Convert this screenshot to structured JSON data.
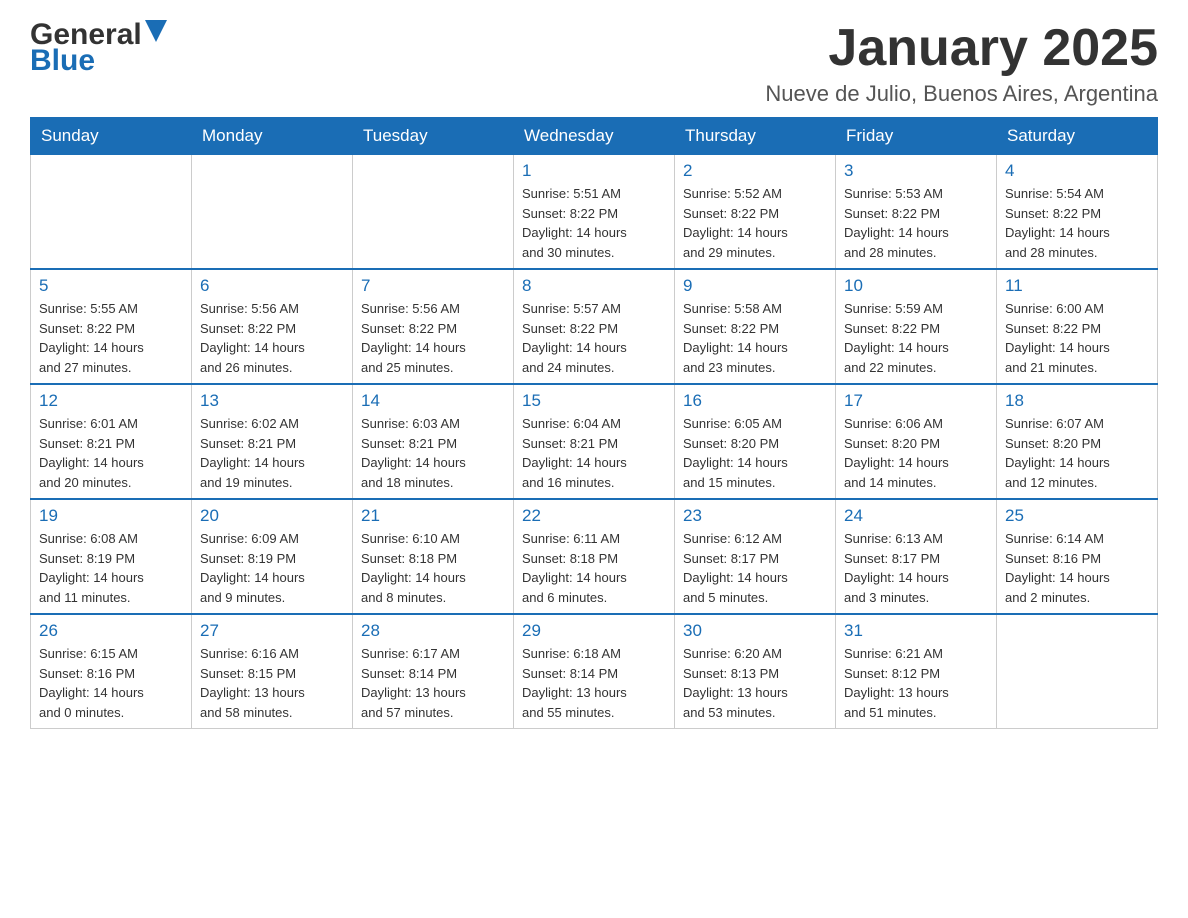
{
  "header": {
    "month_title": "January 2025",
    "location": "Nueve de Julio, Buenos Aires, Argentina",
    "logo_line1": "General",
    "logo_line2": "Blue"
  },
  "days_of_week": [
    "Sunday",
    "Monday",
    "Tuesday",
    "Wednesday",
    "Thursday",
    "Friday",
    "Saturday"
  ],
  "weeks": [
    [
      {
        "day": "",
        "info": ""
      },
      {
        "day": "",
        "info": ""
      },
      {
        "day": "",
        "info": ""
      },
      {
        "day": "1",
        "info": "Sunrise: 5:51 AM\nSunset: 8:22 PM\nDaylight: 14 hours\nand 30 minutes."
      },
      {
        "day": "2",
        "info": "Sunrise: 5:52 AM\nSunset: 8:22 PM\nDaylight: 14 hours\nand 29 minutes."
      },
      {
        "day": "3",
        "info": "Sunrise: 5:53 AM\nSunset: 8:22 PM\nDaylight: 14 hours\nand 28 minutes."
      },
      {
        "day": "4",
        "info": "Sunrise: 5:54 AM\nSunset: 8:22 PM\nDaylight: 14 hours\nand 28 minutes."
      }
    ],
    [
      {
        "day": "5",
        "info": "Sunrise: 5:55 AM\nSunset: 8:22 PM\nDaylight: 14 hours\nand 27 minutes."
      },
      {
        "day": "6",
        "info": "Sunrise: 5:56 AM\nSunset: 8:22 PM\nDaylight: 14 hours\nand 26 minutes."
      },
      {
        "day": "7",
        "info": "Sunrise: 5:56 AM\nSunset: 8:22 PM\nDaylight: 14 hours\nand 25 minutes."
      },
      {
        "day": "8",
        "info": "Sunrise: 5:57 AM\nSunset: 8:22 PM\nDaylight: 14 hours\nand 24 minutes."
      },
      {
        "day": "9",
        "info": "Sunrise: 5:58 AM\nSunset: 8:22 PM\nDaylight: 14 hours\nand 23 minutes."
      },
      {
        "day": "10",
        "info": "Sunrise: 5:59 AM\nSunset: 8:22 PM\nDaylight: 14 hours\nand 22 minutes."
      },
      {
        "day": "11",
        "info": "Sunrise: 6:00 AM\nSunset: 8:22 PM\nDaylight: 14 hours\nand 21 minutes."
      }
    ],
    [
      {
        "day": "12",
        "info": "Sunrise: 6:01 AM\nSunset: 8:21 PM\nDaylight: 14 hours\nand 20 minutes."
      },
      {
        "day": "13",
        "info": "Sunrise: 6:02 AM\nSunset: 8:21 PM\nDaylight: 14 hours\nand 19 minutes."
      },
      {
        "day": "14",
        "info": "Sunrise: 6:03 AM\nSunset: 8:21 PM\nDaylight: 14 hours\nand 18 minutes."
      },
      {
        "day": "15",
        "info": "Sunrise: 6:04 AM\nSunset: 8:21 PM\nDaylight: 14 hours\nand 16 minutes."
      },
      {
        "day": "16",
        "info": "Sunrise: 6:05 AM\nSunset: 8:20 PM\nDaylight: 14 hours\nand 15 minutes."
      },
      {
        "day": "17",
        "info": "Sunrise: 6:06 AM\nSunset: 8:20 PM\nDaylight: 14 hours\nand 14 minutes."
      },
      {
        "day": "18",
        "info": "Sunrise: 6:07 AM\nSunset: 8:20 PM\nDaylight: 14 hours\nand 12 minutes."
      }
    ],
    [
      {
        "day": "19",
        "info": "Sunrise: 6:08 AM\nSunset: 8:19 PM\nDaylight: 14 hours\nand 11 minutes."
      },
      {
        "day": "20",
        "info": "Sunrise: 6:09 AM\nSunset: 8:19 PM\nDaylight: 14 hours\nand 9 minutes."
      },
      {
        "day": "21",
        "info": "Sunrise: 6:10 AM\nSunset: 8:18 PM\nDaylight: 14 hours\nand 8 minutes."
      },
      {
        "day": "22",
        "info": "Sunrise: 6:11 AM\nSunset: 8:18 PM\nDaylight: 14 hours\nand 6 minutes."
      },
      {
        "day": "23",
        "info": "Sunrise: 6:12 AM\nSunset: 8:17 PM\nDaylight: 14 hours\nand 5 minutes."
      },
      {
        "day": "24",
        "info": "Sunrise: 6:13 AM\nSunset: 8:17 PM\nDaylight: 14 hours\nand 3 minutes."
      },
      {
        "day": "25",
        "info": "Sunrise: 6:14 AM\nSunset: 8:16 PM\nDaylight: 14 hours\nand 2 minutes."
      }
    ],
    [
      {
        "day": "26",
        "info": "Sunrise: 6:15 AM\nSunset: 8:16 PM\nDaylight: 14 hours\nand 0 minutes."
      },
      {
        "day": "27",
        "info": "Sunrise: 6:16 AM\nSunset: 8:15 PM\nDaylight: 13 hours\nand 58 minutes."
      },
      {
        "day": "28",
        "info": "Sunrise: 6:17 AM\nSunset: 8:14 PM\nDaylight: 13 hours\nand 57 minutes."
      },
      {
        "day": "29",
        "info": "Sunrise: 6:18 AM\nSunset: 8:14 PM\nDaylight: 13 hours\nand 55 minutes."
      },
      {
        "day": "30",
        "info": "Sunrise: 6:20 AM\nSunset: 8:13 PM\nDaylight: 13 hours\nand 53 minutes."
      },
      {
        "day": "31",
        "info": "Sunrise: 6:21 AM\nSunset: 8:12 PM\nDaylight: 13 hours\nand 51 minutes."
      },
      {
        "day": "",
        "info": ""
      }
    ]
  ],
  "colors": {
    "header_bg": "#1a6db5",
    "blue_text": "#1a6db5"
  }
}
